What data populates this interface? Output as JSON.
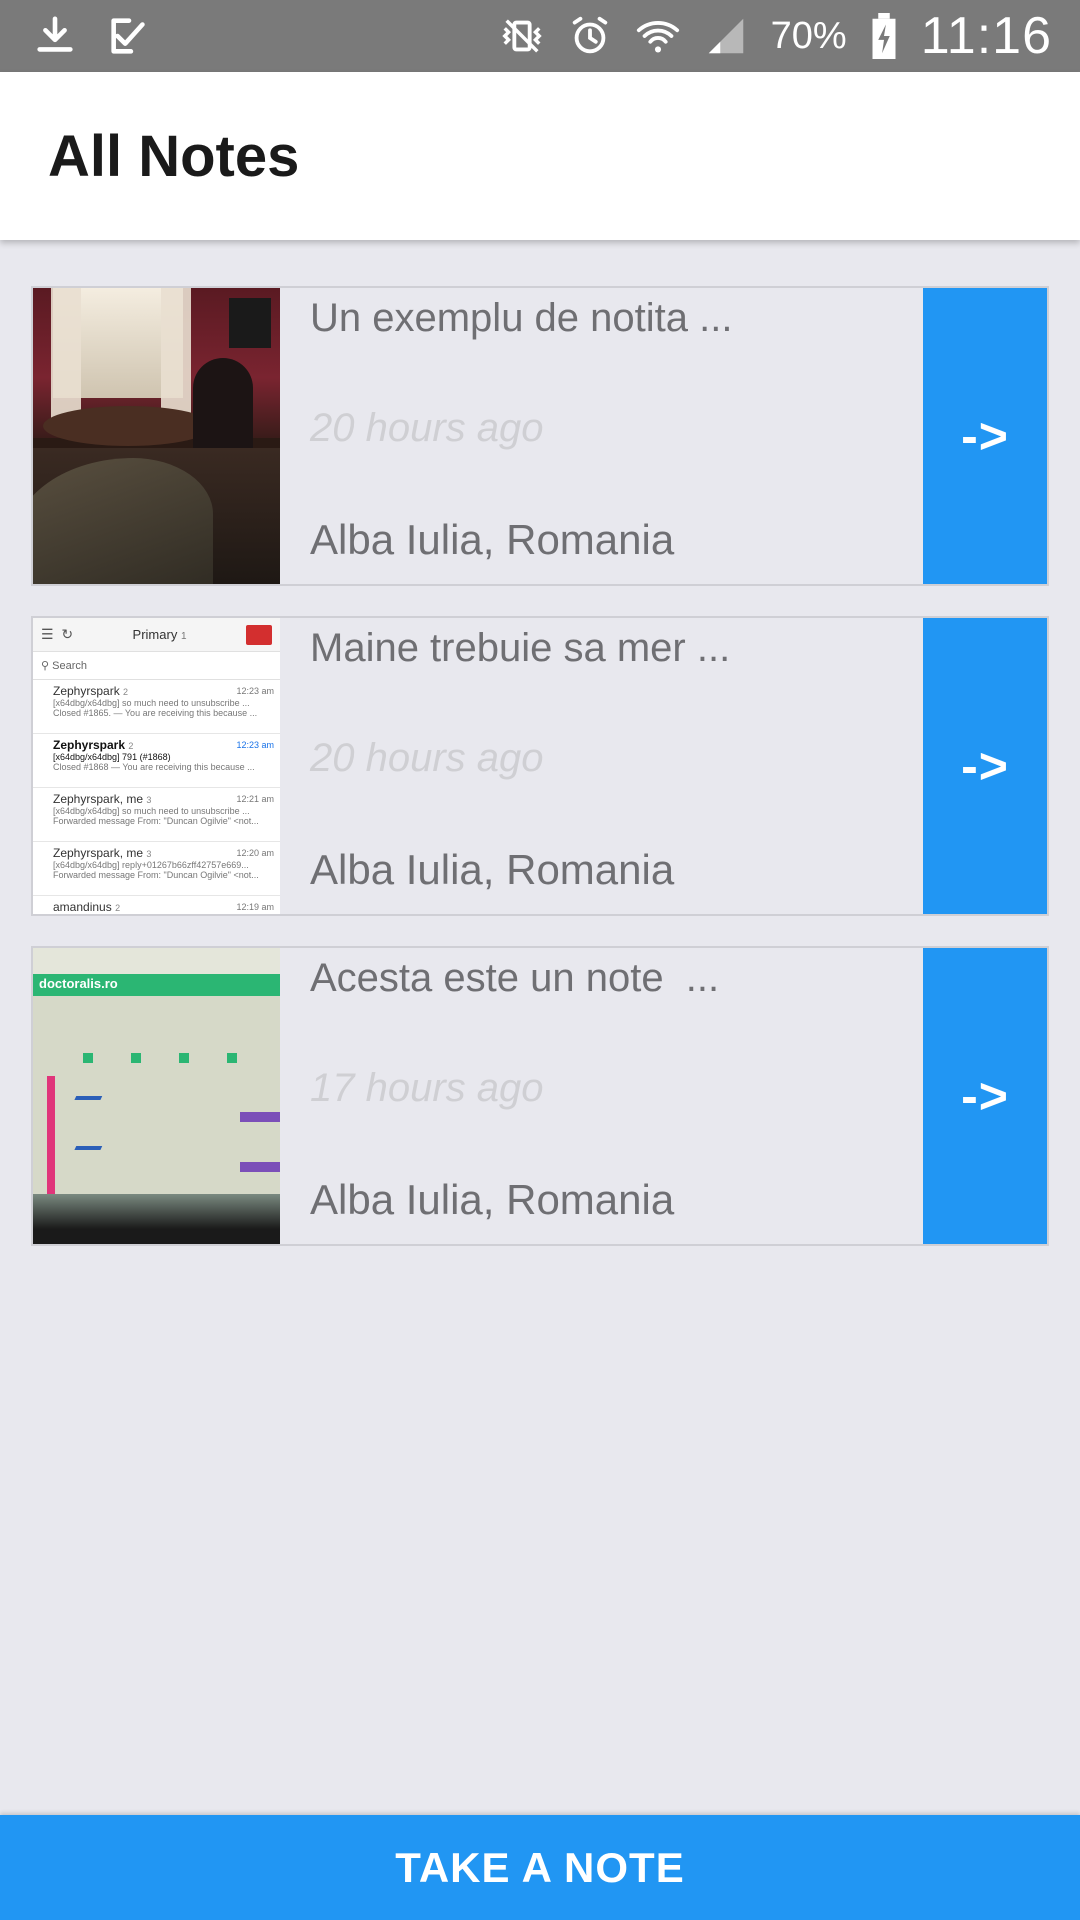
{
  "status_bar": {
    "left_icons": [
      "download-icon",
      "task-done-icon"
    ],
    "right_icons": [
      "vibrate-icon",
      "alarm-icon",
      "wifi-icon",
      "signal-icon",
      "battery-charging-icon"
    ],
    "battery_percent": "70%",
    "time": "11:16"
  },
  "app_bar": {
    "title": "All Notes"
  },
  "notes": [
    {
      "title": "Un exemplu de notita ...",
      "time": "20 hours ago",
      "location": "Alba Iulia, Romania",
      "open_label": "->",
      "thumbnail": "photo"
    },
    {
      "title": "Maine trebuie sa mer ...",
      "time": "20 hours ago",
      "location": "Alba Iulia, Romania",
      "open_label": "->",
      "thumbnail": "mail-screenshot",
      "thumbnail_text": {
        "tab": "Primary",
        "tab_count": "1",
        "search": "Search",
        "rows": [
          {
            "from": "Zephyrspark",
            "count": "2",
            "line1": "[x64dbg/x64dbg] so much need to unsubscribe ...",
            "line2": "Closed #1865. — You are receiving this because ...",
            "time": "12:23 am",
            "bold": false
          },
          {
            "from": "Zephyrspark",
            "count": "2",
            "line1": "[x64dbg/x64dbg] 791 (#1868)",
            "line2": "Closed #1868 — You are receiving this because ...",
            "time": "12:23 am",
            "bold": true
          },
          {
            "from": "Zephyrspark, me",
            "count": "3",
            "line1": "[x64dbg/x64dbg] so much need to unsubscribe ...",
            "line2": "Forwarded message From: \"Duncan Ogilvie\" <not...",
            "time": "12:21 am",
            "bold": false
          },
          {
            "from": "Zephyrspark, me",
            "count": "3",
            "line1": "[x64dbg/x64dbg] reply+01267b66zff42757e669...",
            "line2": "Forwarded message From: \"Duncan Ogilvie\" <not...",
            "time": "12:20 am",
            "bold": false
          },
          {
            "from": "amandinus",
            "count": "2",
            "line1": "",
            "line2": "",
            "time": "12:19 am",
            "bold": false
          }
        ]
      }
    },
    {
      "title": "Acesta este un note  ...",
      "time": "17 hours ago",
      "location": "Alba Iulia, Romania",
      "open_label": "->",
      "thumbnail": "photo",
      "thumbnail_text": {
        "brand": "doctoralis.ro"
      }
    }
  ],
  "take_note_button": {
    "label": "TAKE A NOTE"
  },
  "colors": {
    "accent": "#2196f3",
    "status_bar": "#7a7a7a",
    "background": "#e8e8ee"
  }
}
